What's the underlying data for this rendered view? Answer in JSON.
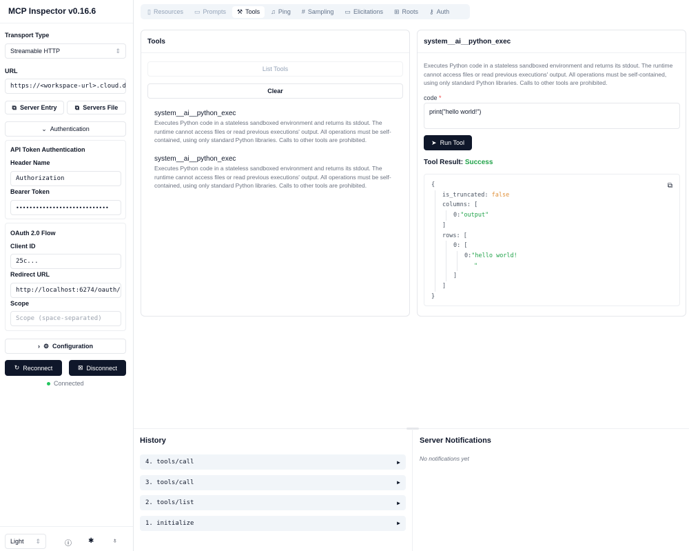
{
  "app": {
    "title": "MCP Inspector v0.16.6"
  },
  "sidebar": {
    "transport_label": "Transport Type",
    "transport_value": "Streamable HTTP",
    "url_label": "URL",
    "url_value": "https://<workspace-url>.cloud.d",
    "server_entry": "Server Entry",
    "servers_file": "Servers File",
    "authentication": "Authentication",
    "api_token": {
      "heading": "API Token Authentication",
      "header_name_label": "Header Name",
      "header_name_value": "Authorization",
      "bearer_label": "Bearer Token",
      "bearer_value": "••••••••••••••••••••••••••••"
    },
    "oauth": {
      "heading": "OAuth 2.0 Flow",
      "client_id_label": "Client ID",
      "client_id_value": "25c...",
      "redirect_label": "Redirect URL",
      "redirect_value": "http://localhost:6274/oauth/",
      "scope_label": "Scope",
      "scope_placeholder": "Scope (space-separated)"
    },
    "configuration": "Configuration",
    "reconnect": "Reconnect",
    "disconnect": "Disconnect",
    "status": "Connected",
    "status_color": "#22c55e",
    "theme": "Light"
  },
  "tabs": [
    {
      "label": "Resources",
      "icon": "file-icon"
    },
    {
      "label": "Prompts",
      "icon": "message-icon"
    },
    {
      "label": "Tools",
      "icon": "hammer-icon",
      "active": true
    },
    {
      "label": "Ping",
      "icon": "bell-icon"
    },
    {
      "label": "Sampling",
      "icon": "hash-icon"
    },
    {
      "label": "Elicitations",
      "icon": "message-icon"
    },
    {
      "label": "Roots",
      "icon": "folder-tree-icon"
    },
    {
      "label": "Auth",
      "icon": "key-icon"
    }
  ],
  "tools_panel": {
    "title": "Tools",
    "list_tools": "List Tools",
    "clear": "Clear",
    "items": [
      {
        "name": "system__ai__python_exec",
        "description": "Executes Python code in a stateless sandboxed environment and returns its stdout. The runtime cannot access files or read previous executions' output. All operations must be self-contained, using only standard Python libraries. Calls to other tools are prohibited."
      },
      {
        "name": "system__ai__python_exec",
        "description": "Executes Python code in a stateless sandboxed environment and returns its stdout. The runtime cannot access files or read previous executions' output. All operations must be self-contained, using only standard Python libraries. Calls to other tools are prohibited."
      }
    ]
  },
  "tool_detail": {
    "title": "system__ai__python_exec",
    "description": "Executes Python code in a stateless sandboxed environment and returns its stdout. The runtime cannot access files or read previous executions' output. All operations must be self-contained, using only standard Python libraries. Calls to other tools are prohibited.",
    "code_label": "code",
    "required_mark": "*",
    "code_value": "print(\"hello world!\")",
    "run_button": "Run Tool",
    "result_label": "Tool Result:",
    "result_status": "Success",
    "result": {
      "open": "{",
      "is_truncated_key": "is_truncated:",
      "is_truncated_val": "false",
      "columns_key": "columns:",
      "lbr": "[",
      "rbr": "]",
      "col0_key": "0:",
      "col0_val": "\"output\"",
      "rows_key": "rows:",
      "row0_key": "0:",
      "cell_key": "0:",
      "cell_val": "\"hello world!",
      "cell_val2": "\"",
      "close": "}"
    }
  },
  "history": {
    "title": "History",
    "items": [
      "4. tools/call",
      "3. tools/call",
      "2. tools/list",
      "1. initialize"
    ]
  },
  "notifications": {
    "title": "Server Notifications",
    "empty": "No notifications yet"
  }
}
